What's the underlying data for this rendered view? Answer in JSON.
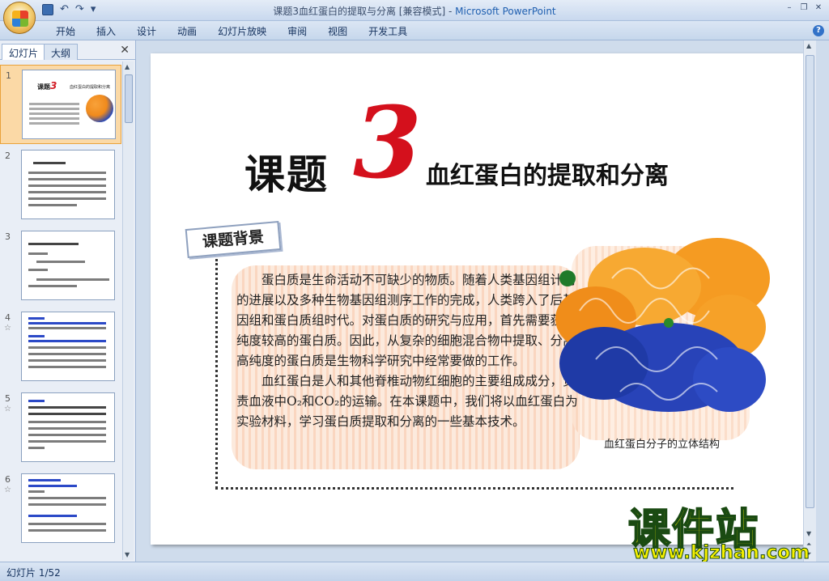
{
  "window": {
    "title": "课题3血红蛋白的提取与分离 [兼容模式] - ",
    "app_name": "Microsoft PowerPoint"
  },
  "quick_access": [
    "save-icon",
    "undo-icon",
    "redo-icon",
    "customize-icon"
  ],
  "ribbon": {
    "tabs": [
      "开始",
      "插入",
      "设计",
      "动画",
      "幻灯片放映",
      "审阅",
      "视图",
      "开发工具"
    ]
  },
  "left_pane": {
    "tabs": [
      "幻灯片",
      "大纲"
    ],
    "close_label": "✕",
    "slides": [
      {
        "num": "1",
        "star": ""
      },
      {
        "num": "2",
        "star": ""
      },
      {
        "num": "3",
        "star": ""
      },
      {
        "num": "4",
        "star": "☆"
      },
      {
        "num": "5",
        "star": "☆"
      },
      {
        "num": "6",
        "star": "☆"
      }
    ]
  },
  "slide": {
    "title": "课题",
    "number": "3",
    "subtitle": "血红蛋白的提取和分离",
    "tag": "课题背景",
    "paragraph1": "蛋白质是生命活动不可缺少的物质。随着人类基因组计划的进展以及多种生物基因组测序工作的完成，人类跨入了后基因组和蛋白质组时代。对蛋白质的研究与应用，首先需要获得纯度较高的蛋白质。因此，从复杂的细胞混合物中提取、分离高纯度的蛋白质是生物科学研究中经常要做的工作。",
    "paragraph2": "血红蛋白是人和其他脊椎动物红细胞的主要组成成分，负责血液中O₂和CO₂的运输。在本课题中，我们将以血红蛋白为实验材料，学习蛋白质提取和分离的一些基本技术。",
    "caption": "血红蛋白分子的立体结构"
  },
  "watermark": {
    "big": "课件站",
    "url": "www.kjzhan.com"
  },
  "status": {
    "slide_indicator": "幻灯片 1/52"
  },
  "colors": {
    "accent_red": "#d4101c",
    "selected_thumb": "#fbd9a6"
  }
}
